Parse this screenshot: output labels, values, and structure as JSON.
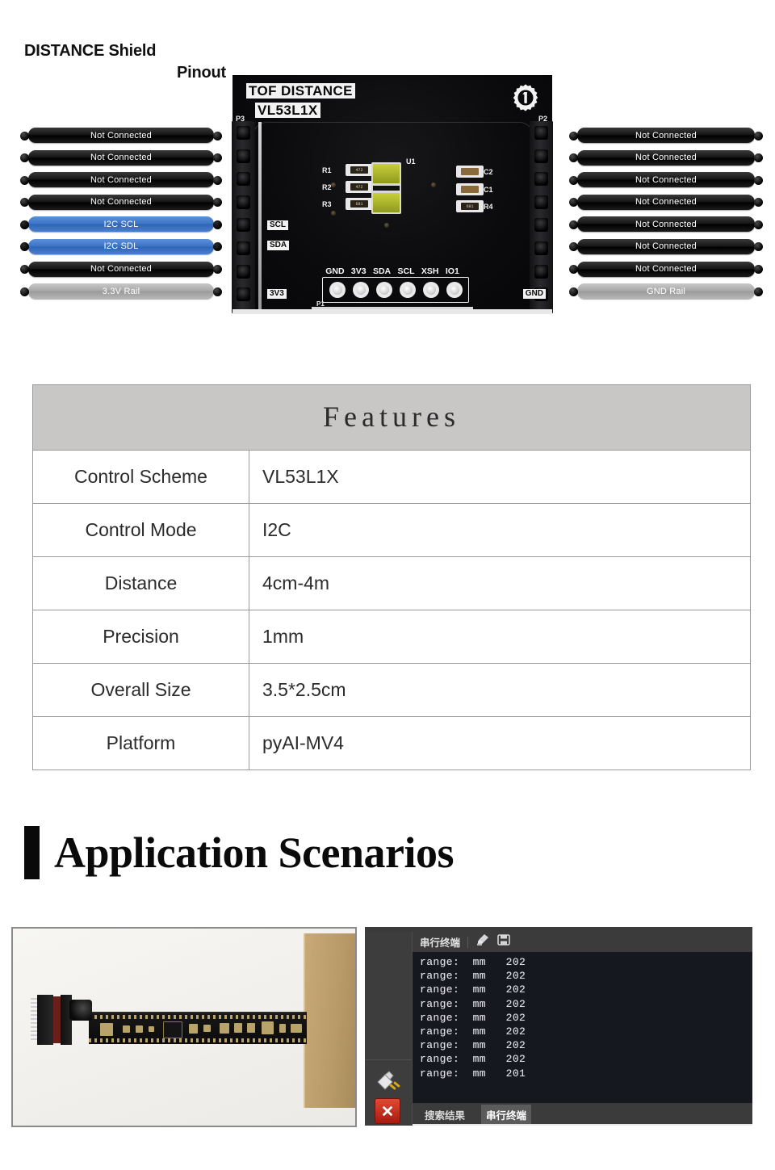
{
  "pinout": {
    "title_line1": "DISTANCE Shield",
    "title_line2": "Pinout",
    "left_pins": [
      {
        "label": "Not Connected",
        "kind": "nc"
      },
      {
        "label": "Not Connected",
        "kind": "nc"
      },
      {
        "label": "Not Connected",
        "kind": "nc"
      },
      {
        "label": "Not Connected",
        "kind": "nc"
      },
      {
        "label": "I2C  SCL",
        "kind": "i2c"
      },
      {
        "label": "I2C  SDL",
        "kind": "i2c"
      },
      {
        "label": "Not Connected",
        "kind": "nc"
      },
      {
        "label": "3.3V Rail",
        "kind": "rail"
      }
    ],
    "right_pins": [
      {
        "label": "Not Connected",
        "kind": "nc"
      },
      {
        "label": "Not Connected",
        "kind": "nc"
      },
      {
        "label": "Not Connected",
        "kind": "nc"
      },
      {
        "label": "Not Connected",
        "kind": "nc"
      },
      {
        "label": "Not Connected",
        "kind": "nc"
      },
      {
        "label": "Not Connected",
        "kind": "nc"
      },
      {
        "label": "Not Connected",
        "kind": "nc"
      },
      {
        "label": "GND Rail",
        "kind": "rail"
      }
    ],
    "accent_blue": "#3a74c6",
    "rail_gray": "#a8a8a8"
  },
  "board": {
    "silk_title": "TOF DISTANCE",
    "silk_part": "VL53L1X",
    "logo_number": "1",
    "header_left_label": "P3",
    "header_right_label": "P2",
    "pad_row_label": "P1",
    "edge_label_scl": "SCL",
    "edge_label_sda": "SDA",
    "edge_label_3v3": "3V3",
    "edge_label_gnd": "GND",
    "pad_labels": [
      "GND",
      "3V3",
      "SDA",
      "SCL",
      "XSH",
      "IO1"
    ],
    "components": [
      {
        "ref": "R1",
        "code": "472"
      },
      {
        "ref": "R2",
        "code": "472"
      },
      {
        "ref": "R3",
        "code": "681"
      },
      {
        "ref": "C2",
        "code": ""
      },
      {
        "ref": "C1",
        "code": ""
      },
      {
        "ref": "R4",
        "code": "681"
      },
      {
        "ref": "U1",
        "code": ""
      }
    ]
  },
  "features": {
    "heading": "Features",
    "rows": [
      {
        "key": "Control Scheme",
        "value": "VL53L1X"
      },
      {
        "key": "Control Mode",
        "value": "I2C"
      },
      {
        "key": "Distance",
        "value": "4cm-4m"
      },
      {
        "key": "Precision",
        "value": "1mm"
      },
      {
        "key": "Overall Size",
        "value": "3.5*2.5cm"
      },
      {
        "key": "Platform",
        "value": "pyAI-MV4"
      }
    ]
  },
  "application": {
    "heading": "Application Scenarios"
  },
  "terminal": {
    "title": "串行终端",
    "lines": [
      "range:  mm   202",
      "range:  mm   202",
      "range:  mm   202",
      "range:  mm   202",
      "range:  mm   202",
      "range:  mm   202",
      "range:  mm   202",
      "range:  mm   202",
      "range:  mm   201"
    ],
    "tabs": [
      {
        "label": "搜索结果",
        "active": false
      },
      {
        "label": "串行终端",
        "active": true
      }
    ]
  }
}
